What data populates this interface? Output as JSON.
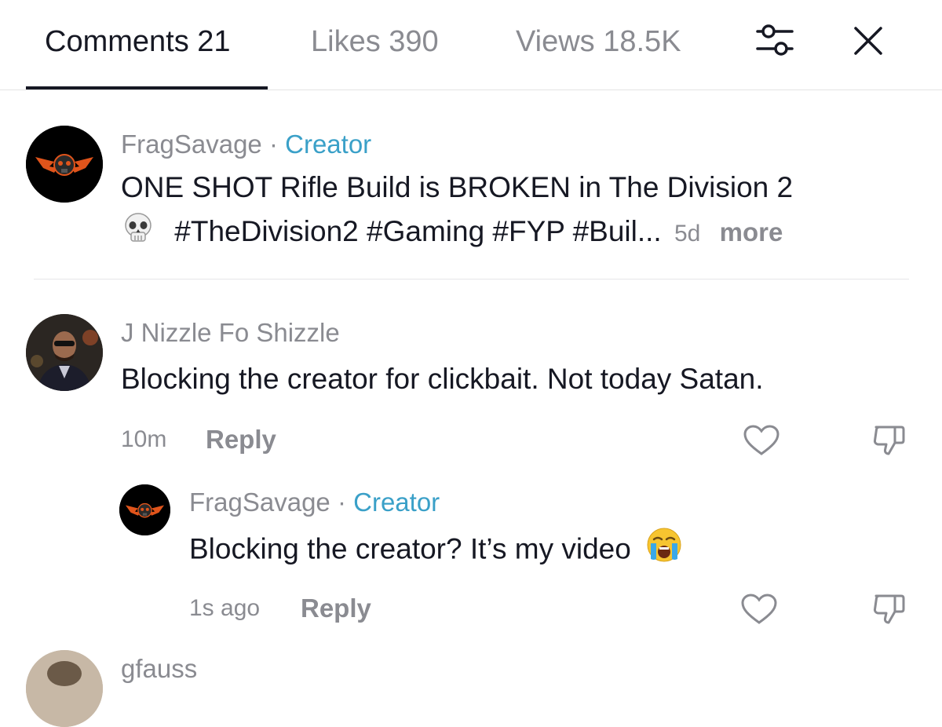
{
  "tabs": {
    "comments": "Comments 21",
    "likes": "Likes 390",
    "views": "Views 18.5K"
  },
  "caption": {
    "username": "FragSavage",
    "separator": "·",
    "creator_label": "Creator",
    "line1": "ONE SHOT Rifle Build is BROKEN in The Division 2",
    "line2": "#TheDivision2 #Gaming #FYP #Buil...",
    "emoji": "skull",
    "timestamp": "5d",
    "more": "more"
  },
  "comments": [
    {
      "username": "J Nizzle Fo Shizzle",
      "text": "Blocking the creator for clickbait. Not today Satan.",
      "timestamp": "10m",
      "reply_label": "Reply",
      "replies": [
        {
          "username": "FragSavage",
          "separator": "·",
          "creator_label": "Creator",
          "text": "Blocking the creator? It’s my video",
          "emoji": "loudly-crying-face",
          "timestamp": "1s ago",
          "reply_label": "Reply"
        }
      ]
    },
    {
      "username": "gfauss"
    }
  ],
  "colors": {
    "creator": "#3aa0c8",
    "muted": "#8a8b91",
    "text": "#161823",
    "accent_orange": "#e0541b"
  }
}
